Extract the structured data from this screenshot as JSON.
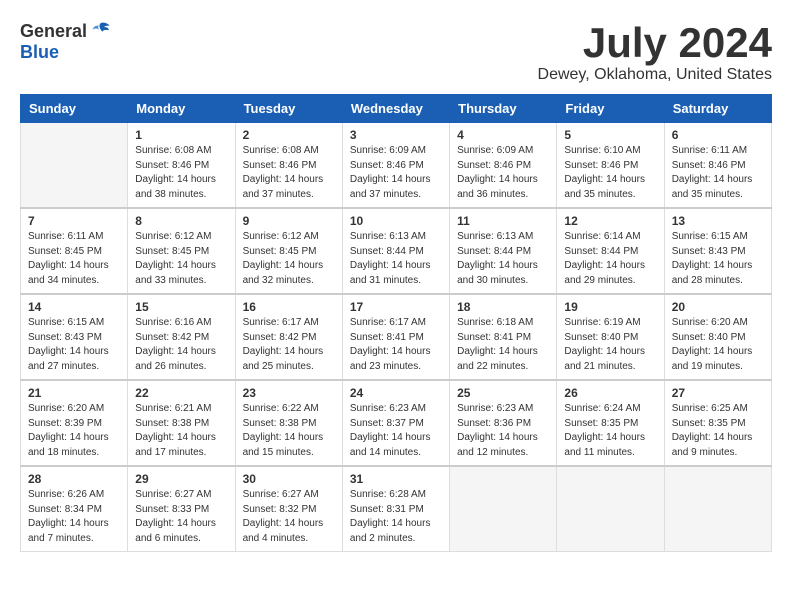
{
  "logo": {
    "general": "General",
    "blue": "Blue"
  },
  "title": "July 2024",
  "subtitle": "Dewey, Oklahoma, United States",
  "days_of_week": [
    "Sunday",
    "Monday",
    "Tuesday",
    "Wednesday",
    "Thursday",
    "Friday",
    "Saturday"
  ],
  "weeks": [
    [
      {
        "day": "",
        "sunrise": "",
        "sunset": "",
        "daylight": ""
      },
      {
        "day": "1",
        "sunrise": "Sunrise: 6:08 AM",
        "sunset": "Sunset: 8:46 PM",
        "daylight": "Daylight: 14 hours and 38 minutes."
      },
      {
        "day": "2",
        "sunrise": "Sunrise: 6:08 AM",
        "sunset": "Sunset: 8:46 PM",
        "daylight": "Daylight: 14 hours and 37 minutes."
      },
      {
        "day": "3",
        "sunrise": "Sunrise: 6:09 AM",
        "sunset": "Sunset: 8:46 PM",
        "daylight": "Daylight: 14 hours and 37 minutes."
      },
      {
        "day": "4",
        "sunrise": "Sunrise: 6:09 AM",
        "sunset": "Sunset: 8:46 PM",
        "daylight": "Daylight: 14 hours and 36 minutes."
      },
      {
        "day": "5",
        "sunrise": "Sunrise: 6:10 AM",
        "sunset": "Sunset: 8:46 PM",
        "daylight": "Daylight: 14 hours and 35 minutes."
      },
      {
        "day": "6",
        "sunrise": "Sunrise: 6:11 AM",
        "sunset": "Sunset: 8:46 PM",
        "daylight": "Daylight: 14 hours and 35 minutes."
      }
    ],
    [
      {
        "day": "7",
        "sunrise": "Sunrise: 6:11 AM",
        "sunset": "Sunset: 8:45 PM",
        "daylight": "Daylight: 14 hours and 34 minutes."
      },
      {
        "day": "8",
        "sunrise": "Sunrise: 6:12 AM",
        "sunset": "Sunset: 8:45 PM",
        "daylight": "Daylight: 14 hours and 33 minutes."
      },
      {
        "day": "9",
        "sunrise": "Sunrise: 6:12 AM",
        "sunset": "Sunset: 8:45 PM",
        "daylight": "Daylight: 14 hours and 32 minutes."
      },
      {
        "day": "10",
        "sunrise": "Sunrise: 6:13 AM",
        "sunset": "Sunset: 8:44 PM",
        "daylight": "Daylight: 14 hours and 31 minutes."
      },
      {
        "day": "11",
        "sunrise": "Sunrise: 6:13 AM",
        "sunset": "Sunset: 8:44 PM",
        "daylight": "Daylight: 14 hours and 30 minutes."
      },
      {
        "day": "12",
        "sunrise": "Sunrise: 6:14 AM",
        "sunset": "Sunset: 8:44 PM",
        "daylight": "Daylight: 14 hours and 29 minutes."
      },
      {
        "day": "13",
        "sunrise": "Sunrise: 6:15 AM",
        "sunset": "Sunset: 8:43 PM",
        "daylight": "Daylight: 14 hours and 28 minutes."
      }
    ],
    [
      {
        "day": "14",
        "sunrise": "Sunrise: 6:15 AM",
        "sunset": "Sunset: 8:43 PM",
        "daylight": "Daylight: 14 hours and 27 minutes."
      },
      {
        "day": "15",
        "sunrise": "Sunrise: 6:16 AM",
        "sunset": "Sunset: 8:42 PM",
        "daylight": "Daylight: 14 hours and 26 minutes."
      },
      {
        "day": "16",
        "sunrise": "Sunrise: 6:17 AM",
        "sunset": "Sunset: 8:42 PM",
        "daylight": "Daylight: 14 hours and 25 minutes."
      },
      {
        "day": "17",
        "sunrise": "Sunrise: 6:17 AM",
        "sunset": "Sunset: 8:41 PM",
        "daylight": "Daylight: 14 hours and 23 minutes."
      },
      {
        "day": "18",
        "sunrise": "Sunrise: 6:18 AM",
        "sunset": "Sunset: 8:41 PM",
        "daylight": "Daylight: 14 hours and 22 minutes."
      },
      {
        "day": "19",
        "sunrise": "Sunrise: 6:19 AM",
        "sunset": "Sunset: 8:40 PM",
        "daylight": "Daylight: 14 hours and 21 minutes."
      },
      {
        "day": "20",
        "sunrise": "Sunrise: 6:20 AM",
        "sunset": "Sunset: 8:40 PM",
        "daylight": "Daylight: 14 hours and 19 minutes."
      }
    ],
    [
      {
        "day": "21",
        "sunrise": "Sunrise: 6:20 AM",
        "sunset": "Sunset: 8:39 PM",
        "daylight": "Daylight: 14 hours and 18 minutes."
      },
      {
        "day": "22",
        "sunrise": "Sunrise: 6:21 AM",
        "sunset": "Sunset: 8:38 PM",
        "daylight": "Daylight: 14 hours and 17 minutes."
      },
      {
        "day": "23",
        "sunrise": "Sunrise: 6:22 AM",
        "sunset": "Sunset: 8:38 PM",
        "daylight": "Daylight: 14 hours and 15 minutes."
      },
      {
        "day": "24",
        "sunrise": "Sunrise: 6:23 AM",
        "sunset": "Sunset: 8:37 PM",
        "daylight": "Daylight: 14 hours and 14 minutes."
      },
      {
        "day": "25",
        "sunrise": "Sunrise: 6:23 AM",
        "sunset": "Sunset: 8:36 PM",
        "daylight": "Daylight: 14 hours and 12 minutes."
      },
      {
        "day": "26",
        "sunrise": "Sunrise: 6:24 AM",
        "sunset": "Sunset: 8:35 PM",
        "daylight": "Daylight: 14 hours and 11 minutes."
      },
      {
        "day": "27",
        "sunrise": "Sunrise: 6:25 AM",
        "sunset": "Sunset: 8:35 PM",
        "daylight": "Daylight: 14 hours and 9 minutes."
      }
    ],
    [
      {
        "day": "28",
        "sunrise": "Sunrise: 6:26 AM",
        "sunset": "Sunset: 8:34 PM",
        "daylight": "Daylight: 14 hours and 7 minutes."
      },
      {
        "day": "29",
        "sunrise": "Sunrise: 6:27 AM",
        "sunset": "Sunset: 8:33 PM",
        "daylight": "Daylight: 14 hours and 6 minutes."
      },
      {
        "day": "30",
        "sunrise": "Sunrise: 6:27 AM",
        "sunset": "Sunset: 8:32 PM",
        "daylight": "Daylight: 14 hours and 4 minutes."
      },
      {
        "day": "31",
        "sunrise": "Sunrise: 6:28 AM",
        "sunset": "Sunset: 8:31 PM",
        "daylight": "Daylight: 14 hours and 2 minutes."
      },
      {
        "day": "",
        "sunrise": "",
        "sunset": "",
        "daylight": ""
      },
      {
        "day": "",
        "sunrise": "",
        "sunset": "",
        "daylight": ""
      },
      {
        "day": "",
        "sunrise": "",
        "sunset": "",
        "daylight": ""
      }
    ]
  ]
}
